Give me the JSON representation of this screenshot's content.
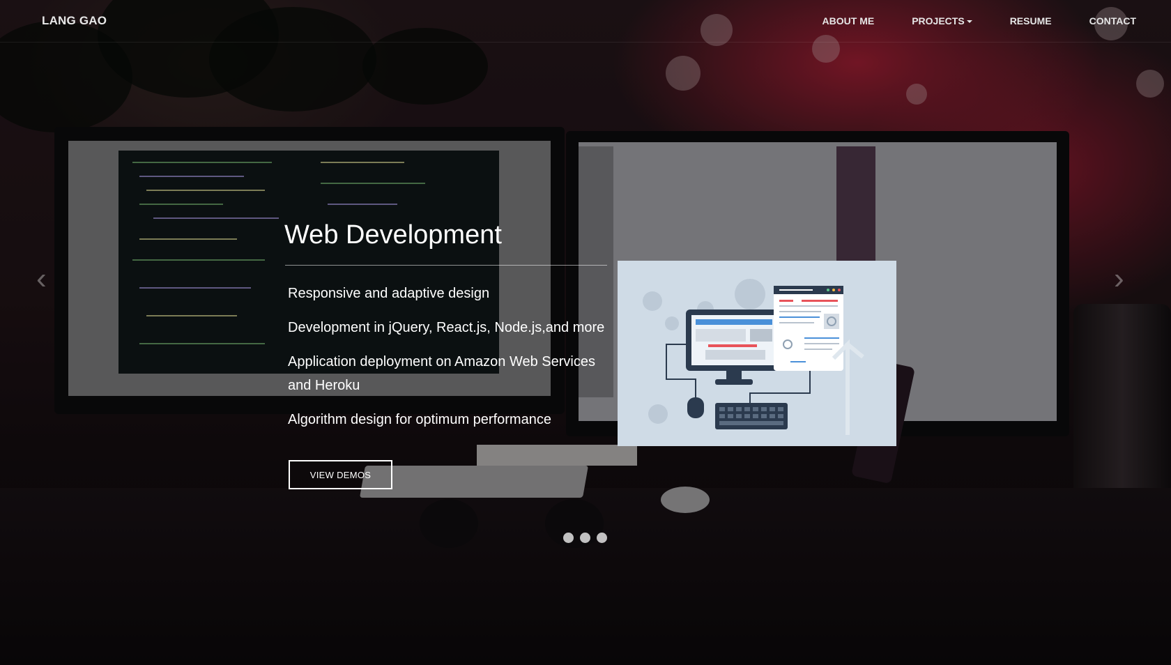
{
  "nav": {
    "brand": "LANG GAO",
    "links": [
      {
        "label": "ABOUT ME"
      },
      {
        "label": "PROJECTS",
        "has_dropdown": true
      },
      {
        "label": "RESUME"
      },
      {
        "label": "CONTACT"
      }
    ]
  },
  "carousel": {
    "active_slide": 1,
    "slide_count": 3,
    "prev_icon": "chevron-left-icon",
    "next_icon": "chevron-right-icon",
    "slide": {
      "title": "Web Development",
      "features": [
        "Responsive and adaptive design",
        "Development in jQuery, React.js, Node.js,and more",
        "Application deployment on Amazon Web Services and Heroku",
        "Algorithm design for optimum performance"
      ],
      "button_label": "VIEW DEMOS",
      "illustration": "web-development-illustration"
    }
  },
  "colors": {
    "overlay_text": "#ffffff",
    "background_accent": "#b8223c",
    "illustration_bg": "#cfdbe6"
  }
}
